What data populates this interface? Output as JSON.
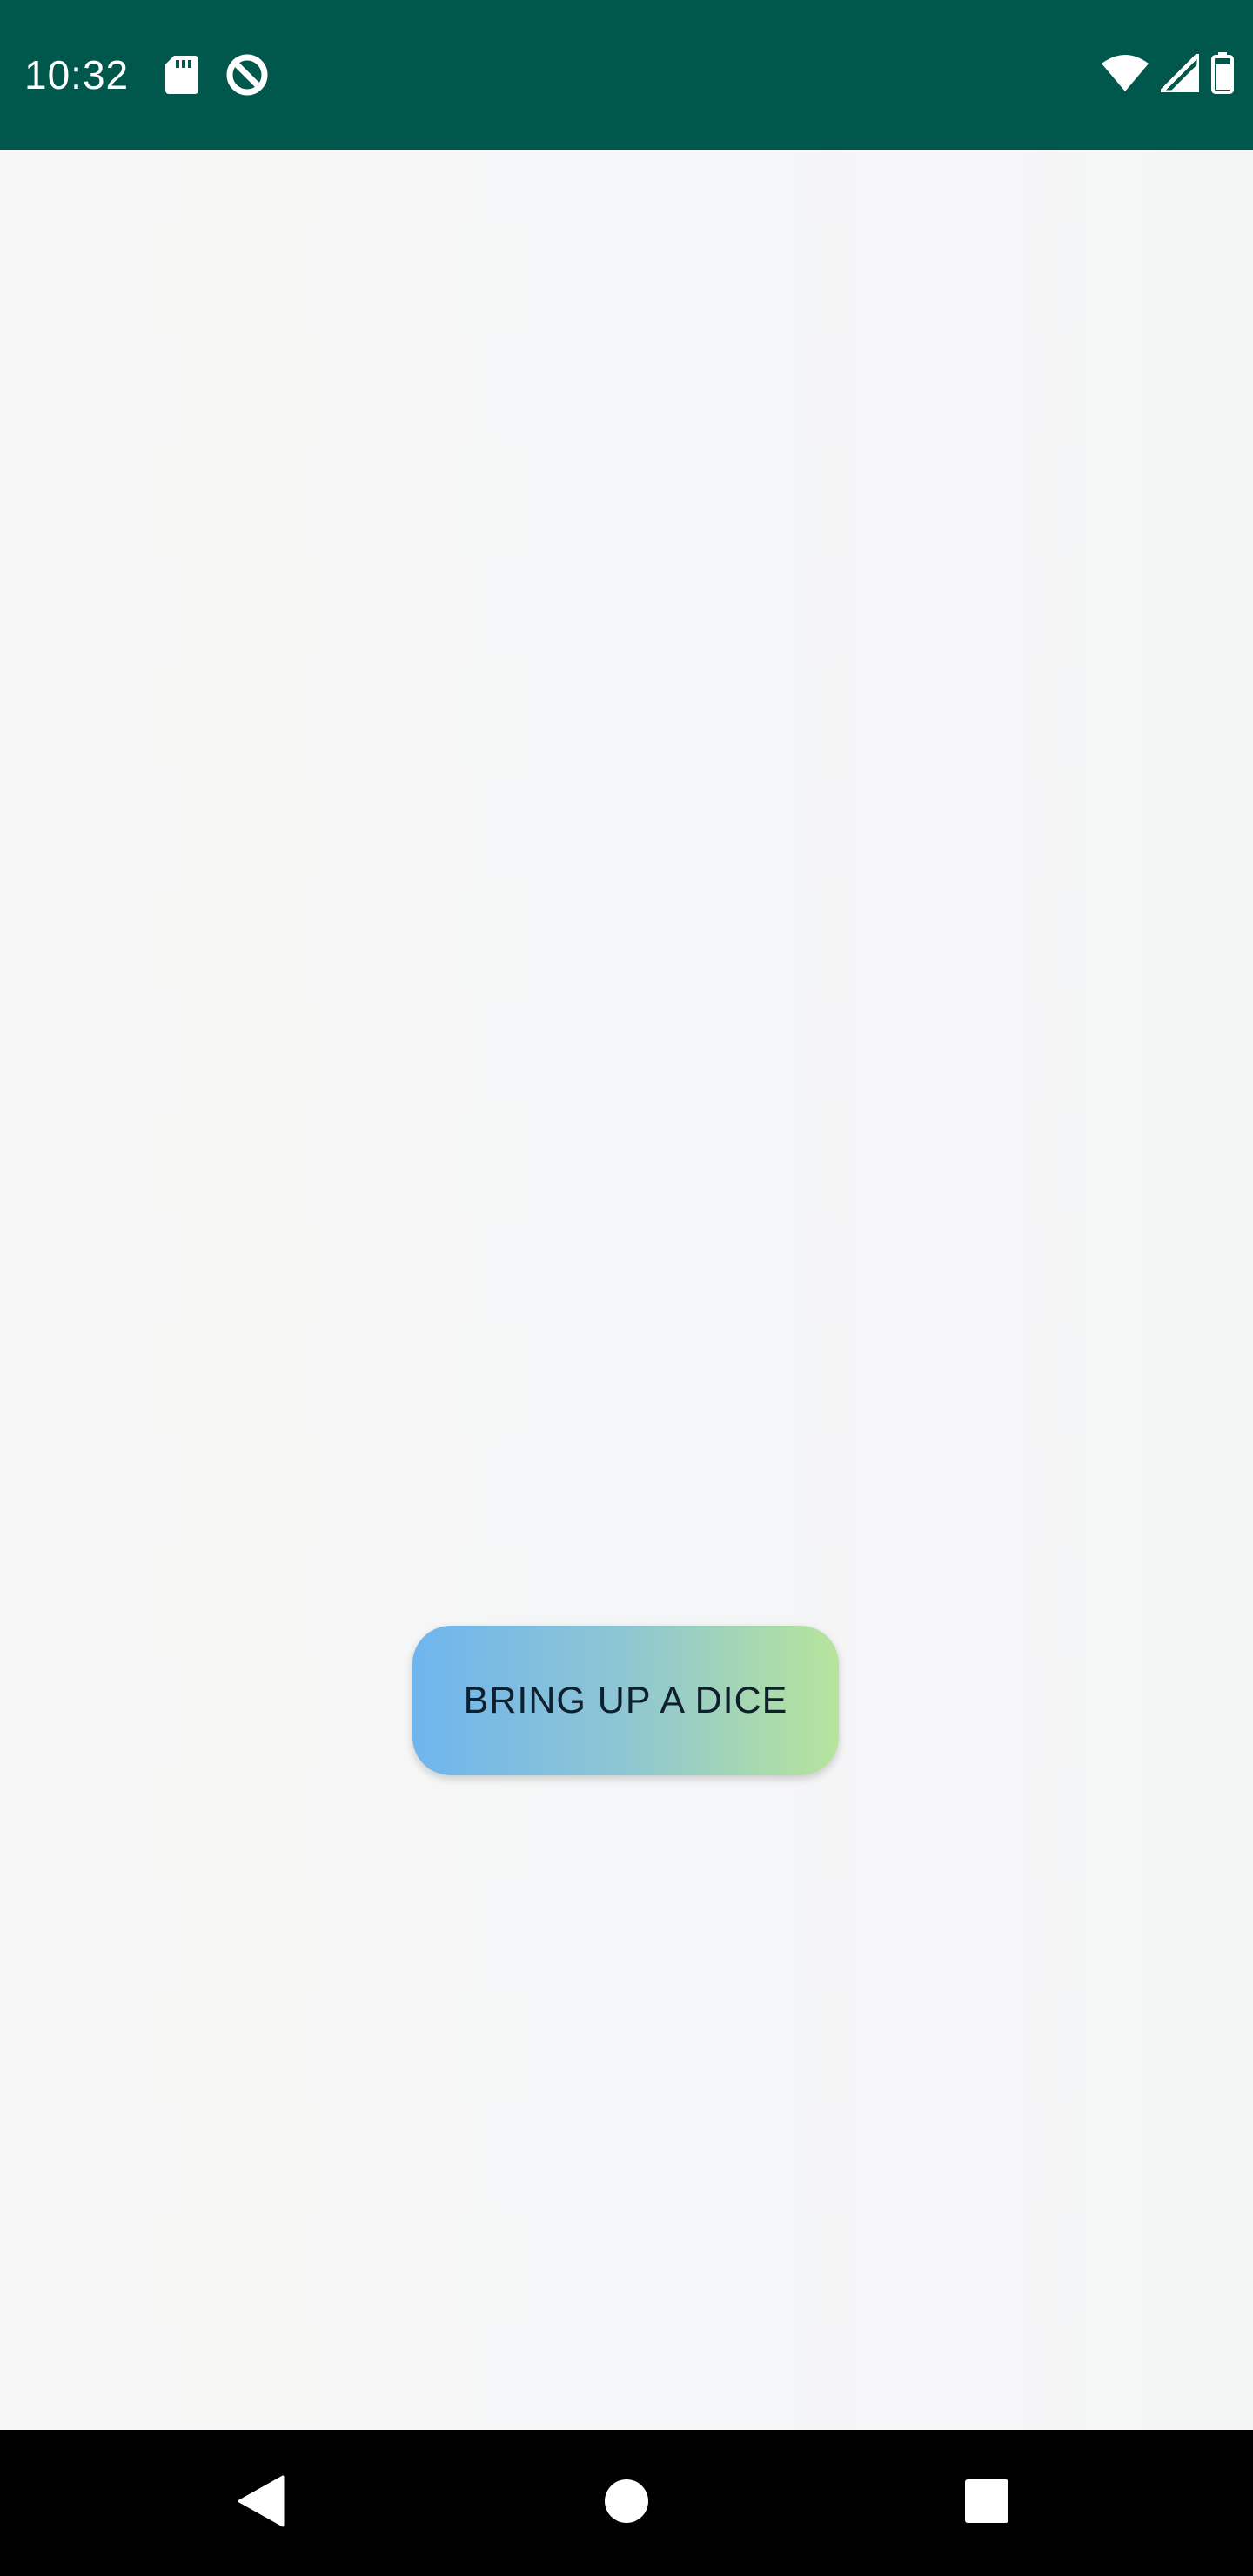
{
  "status_bar": {
    "time": "10:32",
    "left_icons": [
      "sd-card-icon",
      "data-saver-icon"
    ],
    "right_icons": [
      "wifi-icon",
      "cellular-signal-icon",
      "battery-icon"
    ],
    "background_color": "#00574b"
  },
  "main": {
    "dice_button_label": "BRING UP A DICE",
    "button_gradient": [
      "#6fb5ee",
      "#b7e49c"
    ]
  },
  "nav_bar": {
    "buttons": [
      "back-icon",
      "home-icon",
      "recents-icon"
    ]
  }
}
